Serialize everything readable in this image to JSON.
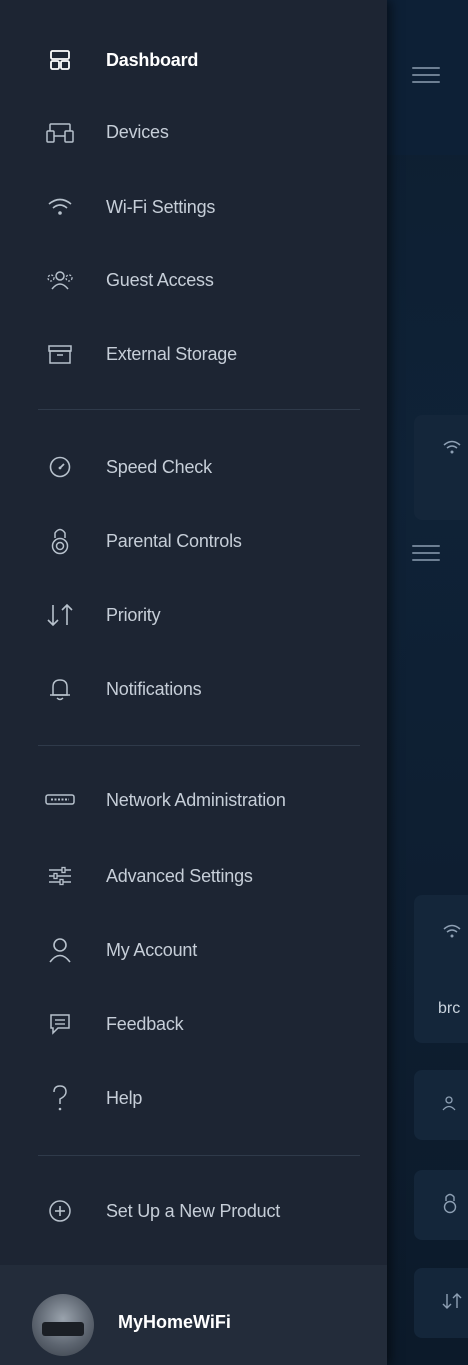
{
  "menu": {
    "items": [
      {
        "label": "Dashboard",
        "icon": "dashboard-icon"
      },
      {
        "label": "Devices",
        "icon": "devices-icon"
      },
      {
        "label": "Wi-Fi Settings",
        "icon": "wifi-icon"
      },
      {
        "label": "Guest Access",
        "icon": "guest-icon"
      },
      {
        "label": "External Storage",
        "icon": "storage-icon"
      },
      {
        "label": "Speed Check",
        "icon": "speedometer-icon"
      },
      {
        "label": "Parental Controls",
        "icon": "lock-icon"
      },
      {
        "label": "Priority",
        "icon": "priority-arrows-icon"
      },
      {
        "label": "Notifications",
        "icon": "bell-icon"
      },
      {
        "label": "Network Administration",
        "icon": "router-icon"
      },
      {
        "label": "Advanced Settings",
        "icon": "sliders-icon"
      },
      {
        "label": "My Account",
        "icon": "person-icon"
      },
      {
        "label": "Feedback",
        "icon": "chat-icon"
      },
      {
        "label": "Help",
        "icon": "question-icon"
      },
      {
        "label": "Set Up a New Product",
        "icon": "plus-circle-icon"
      }
    ]
  },
  "footer": {
    "network_name": "MyHomeWiFi"
  },
  "background": {
    "card_text": "brc"
  },
  "colors": {
    "drawer_bg": "#1d2533",
    "app_bg": "#0f2237",
    "text": "#c6ced8",
    "active_text": "#ffffff"
  }
}
